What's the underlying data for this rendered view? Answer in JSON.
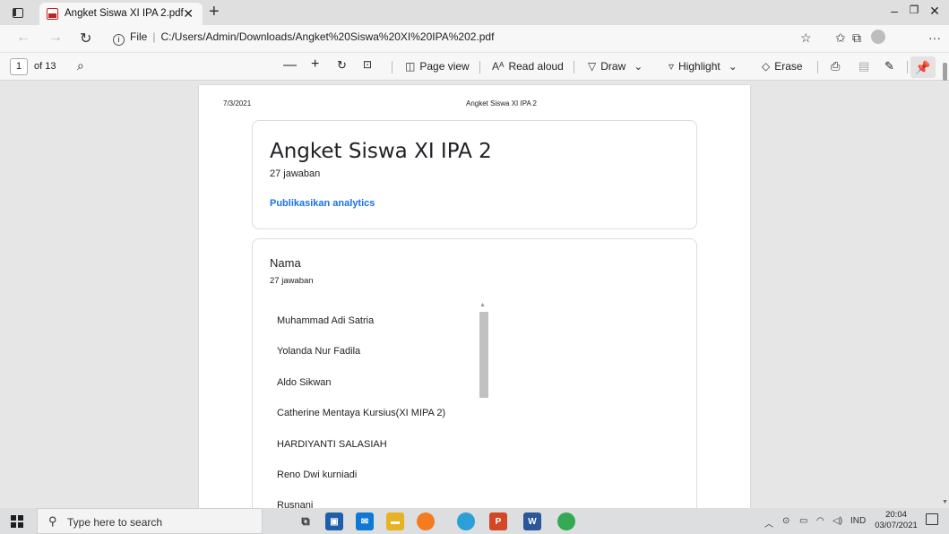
{
  "browser": {
    "tab_title": "Angket Siswa XI IPA 2.pdf",
    "tab_close": "✕",
    "new_tab": "+",
    "url_prefix": "File",
    "url": "C:/Users/Admin/Downloads/Angket%20Siswa%20XI%20IPA%202.pdf"
  },
  "pdf_toolbar": {
    "page_number": "1",
    "page_of": "of 13",
    "page_view": "Page view",
    "read_aloud": "Read aloud",
    "draw": "Draw",
    "highlight": "Highlight",
    "erase": "Erase"
  },
  "page": {
    "header_date": "7/3/2021",
    "header_title": "Angket Siswa XI IPA 2",
    "form_title": "Angket Siswa XI IPA 2",
    "response_count": "27 jawaban",
    "publish_link": "Publikasikan analytics",
    "question": {
      "title": "Nama",
      "response_count": "27 jawaban",
      "responses": [
        "Muhammad Adi Satria",
        "Yolanda Nur Fadila",
        "Aldo Sikwan",
        "Catherine Mentaya Kursius(XI MIPA 2)",
        "HARDIYANTI SALASIAH",
        "Reno Dwi kurniadi",
        "Rusnani"
      ]
    }
  },
  "taskbar": {
    "search_placeholder": "Type here to search",
    "language": "IND",
    "time": "20:04",
    "date": "03/07/2021"
  }
}
